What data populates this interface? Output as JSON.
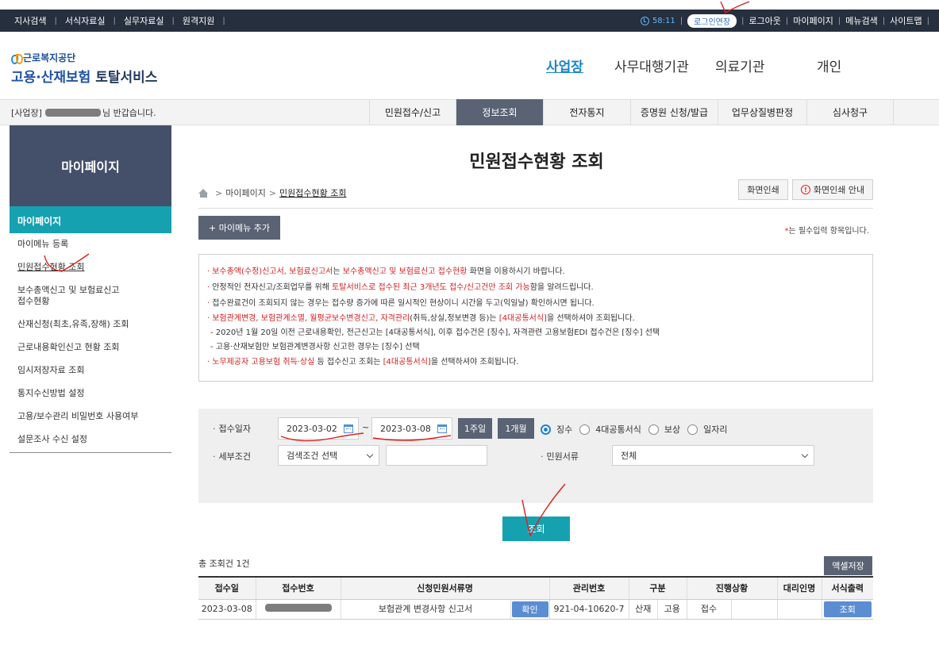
{
  "topbar": {
    "links": [
      "지사검색",
      "서식자료실",
      "실무자료실",
      "원격지원"
    ],
    "timer": "58:11",
    "extend_login": "로그인연장",
    "logout": "로그아웃",
    "mypage": "마이페이지",
    "menu_search": "메뉴검색",
    "sitemap": "사이트맵"
  },
  "logo": {
    "org": "근로복지공단",
    "service_a": "고용·산재보험",
    "service_b": "토탈서비스"
  },
  "main_nav": [
    "사업장",
    "사무대행기관",
    "의료기관",
    "개인"
  ],
  "welcome": {
    "prefix": "[사업장]",
    "suffix": "님 반갑습니다."
  },
  "sub_nav": [
    "민원접수/신고",
    "정보조회",
    "전자통지",
    "증명원 신청/발급",
    "업무상질병판정",
    "심사청구"
  ],
  "sidebar": {
    "header": "마이페이지",
    "title": "마이페이지",
    "items": [
      "마이메뉴 등록",
      "민원접수현황 조회",
      "보수총액신고 및 보험료신고",
      "접수현황",
      "산재신청(최초,유족,장해) 조회",
      "근로내용확인신고 현황 조회",
      "임시저장자료 조회",
      "통지수신방법 설정",
      "고용/보수관리 비밀번호 사용여부",
      "설문조사 수신 설정"
    ]
  },
  "page": {
    "title": "민원접수현황 조회",
    "breadcrumb_parent": "마이페이지",
    "breadcrumb_current": "민원접수현황 조회",
    "print_btn": "화면인쇄",
    "print_guide_btn": "화면인쇄 안내",
    "add_mymenu": "+ 마이메뉴 추가",
    "required_star": "*",
    "required_note": "는 필수입력 항목입니다."
  },
  "notice": {
    "l1a": "보수총액(수정)신고서, 보험료신고서",
    "l1b": "는 ",
    "l1c": "보수총액신고 및 보험료신고 접수현황",
    "l1d": " 화면을 이용하시기 바랍니다.",
    "l2a": "안정적인 전자신고/조회업무를 위해 ",
    "l2b": "토탈서비스로 접수된 최근 3개년도 접수/신고건만 조회 가능",
    "l2c": "함을 알려드립니다.",
    "l3": "접수완료건이 조회되지 않는 경우는 접수량 증가에 따른 일시적인 현상이니 시간을 두고(익일날) 확인하시면 됩니다.",
    "l4a": "보험관계변경, 보험관계소멸, 월평균보수변경신고, 자격관리",
    "l4b": "(취득,상실,정보변경 등)는 ",
    "l4c": "[4대공통서식]",
    "l4d": "을 선택하셔야 조회됩니다.",
    "l5": "- 2020년 1월 20일 이전 근로내용확인, 전근신고는 [4대공통서식], 이후 접수건은 [징수], 자격관련 고용보험EDI 접수건은 [징수] 선택",
    "l6": "- 고용·산재보험만 보험관계변경사항 신고한 경우는 [징수] 선택",
    "l7a": "노무제공자 고용보험 취득·상실",
    "l7b": " 등 접수신고 조회는 ",
    "l7c": "[4대공통서식]",
    "l7d": "을 선택하셔야 조회됩니다."
  },
  "search": {
    "date_label": "접수일자",
    "date_from": "2023-03-02",
    "tilde": "~",
    "date_to": "2023-03-08",
    "btn_1week": "1주일",
    "btn_1month": "1개월",
    "radios": [
      "징수",
      "4대공통서식",
      "보상",
      "일자리"
    ],
    "detail_label": "세부조건",
    "detail_select": "검색조건 선택",
    "doc_label": "민원서류",
    "doc_select": "전체",
    "query_btn": "조회"
  },
  "results": {
    "total": "총 조회건 1건",
    "excel_btn": "액셀저장",
    "columns": [
      "접수일",
      "접수번호",
      "신청민원서류명",
      "관리번호",
      "구분",
      "진행상황",
      "대리인명",
      "서식출력"
    ],
    "row": {
      "date": "2023-03-08",
      "doc_name": "보험관계 변경사항 신고서",
      "confirm_btn": "확인",
      "mgmt_no": "921-04-10620-7",
      "type_a": "산재",
      "type_b": "고용",
      "status": "접수",
      "view_btn": "조회"
    }
  },
  "colors": {
    "topbar": "#262f3d",
    "accent_teal": "#16a1b1",
    "dark_button": "#5a6374",
    "blue_button": "#5b8dd2",
    "alert_red": "#d42020",
    "annotation_red": "#e02020"
  }
}
